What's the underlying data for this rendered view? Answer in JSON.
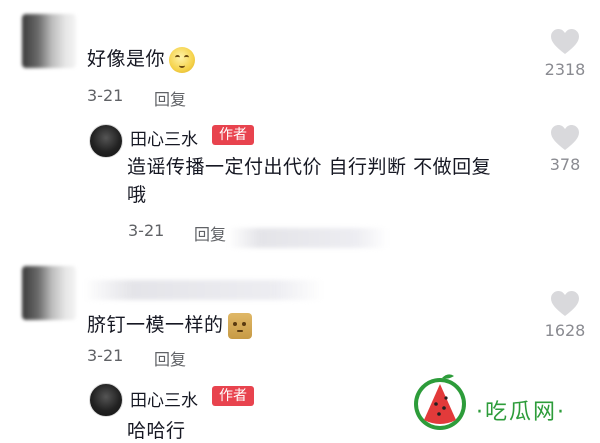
{
  "comments": [
    {
      "text": "好像是你",
      "date": "3-21",
      "reply_label": "回复",
      "likes": "2318",
      "emoji": "shy-face-emoji"
    },
    {
      "text": "脐钉一模一样的",
      "date": "3-21",
      "reply_label": "回复",
      "likes": "1628",
      "emoji": "cat-emoji"
    }
  ],
  "replies": [
    {
      "author": "田心三水",
      "badge": "作者",
      "text_line1": "造谣传播一定付出代价 自行判断 不做回复",
      "text_line2": "哦",
      "date": "3-21",
      "reply_label": "回复",
      "likes": "378"
    },
    {
      "author": "田心三水",
      "badge": "作者",
      "text_line1": "哈哈行"
    }
  ],
  "watermark": {
    "text": "·吃瓜网·",
    "icon": "watermelon-icon"
  },
  "colors": {
    "badge": "#e8434e",
    "heart": "#d9d9dc",
    "watermark_green": "#2d9c3a",
    "watermelon_red": "#e23a3a"
  }
}
